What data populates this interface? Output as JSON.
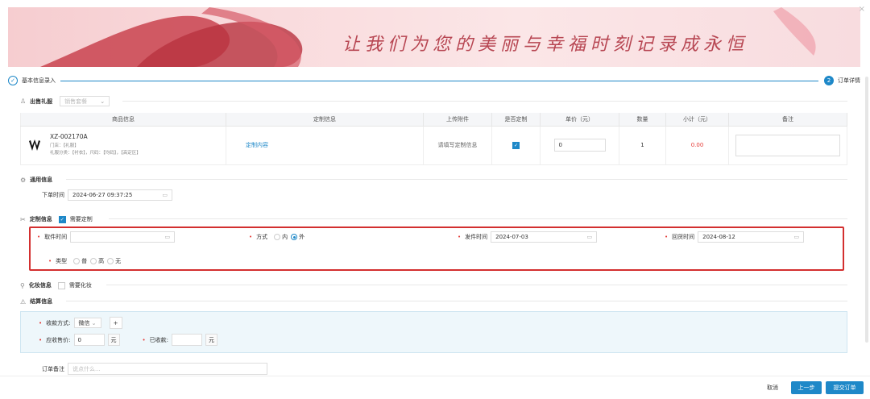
{
  "banner": {
    "slogan": "让我们为您的美丽与幸福时刻记录成永恒",
    "close": "×"
  },
  "steps": {
    "step1_label": "基本信息录入",
    "step1_icon": "✓",
    "step2_number": "2",
    "step2_label": "订单详情"
  },
  "dress": {
    "title": "出售礼服",
    "select_placeholder": "销售套餐",
    "headers": [
      "商品信息",
      "定制信息",
      "上传附件",
      "是否定制",
      "单价（元）",
      "数量",
      "小计（元）",
      "备注"
    ],
    "row": {
      "code": "XZ-002170A",
      "store": "门店：【礼服】",
      "category": "礼服分类：【衬衣】，尺码：【均码】，【高定区】",
      "custom_link": "定制内容",
      "attachment": "请填写定制信息",
      "custom_checked": "✓",
      "unit_price": "0",
      "quantity": "1",
      "subtotal": "0.00",
      "remark": ""
    }
  },
  "general": {
    "title": "通用信息",
    "order_time_label": "下单时间",
    "order_time": "2024-06-27 09:37:25"
  },
  "custom": {
    "title": "定制信息",
    "need_custom_label": "需要定制",
    "pickup_time_label": "取件时间",
    "pickup_time": "",
    "method_label": "方式",
    "method_options": [
      "内",
      "外"
    ],
    "method_selected": "外",
    "ship_time_label": "发件时间",
    "ship_time": "2024-07-03",
    "return_time_label": "回货时间",
    "return_time": "2024-08-12",
    "type_label": "类型",
    "type_options": [
      "普",
      "高",
      "无"
    ]
  },
  "makeup": {
    "title": "化妆信息",
    "need_makeup_label": "需要化妆"
  },
  "settle": {
    "title": "结算信息",
    "payment_method_label": "收款方式:",
    "payment_method": "微信",
    "add": "+",
    "receivable_label": "应收售价:",
    "receivable": "0",
    "received_label": "已收款:",
    "received": "",
    "unit": "元"
  },
  "order_remark": {
    "label": "订单备注",
    "placeholder": "说点什么..."
  },
  "footer": {
    "cancel": "取消",
    "prev": "上一步",
    "submit": "提交订单"
  },
  "colors": {
    "accent": "#1e88c8",
    "required": "#e53935",
    "highlight": "#d32f2f",
    "subtotal": "#e53935"
  }
}
